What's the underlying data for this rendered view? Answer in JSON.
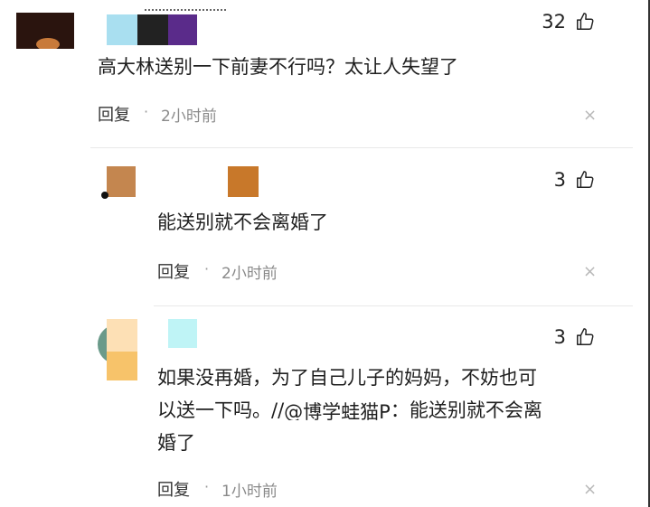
{
  "comments": [
    {
      "text": "高大林送别一下前妻不行吗？太让人失望了",
      "reply_label": "回复",
      "dot": "·",
      "time": "2小时前",
      "likes": "32",
      "close": "×",
      "icons": [
        "thumbs-up-icon",
        "close-icon"
      ]
    },
    {
      "text": "能送别就不会离婚了",
      "reply_label": "回复",
      "dot": "·",
      "time": "2小时前",
      "likes": "3",
      "close": "×"
    },
    {
      "text_line1": "如果没再婚，为了自己儿子的妈妈，不妨也可",
      "text_line2_a": "以送一下吗。//",
      "text_line2_mention": "@博学蛙猫P",
      "text_line2_b": "：能送别就不会离",
      "text_line3": "婚了",
      "reply_label": "回复",
      "dot": "·",
      "time": "1小时前",
      "likes": "3",
      "close": "×"
    }
  ],
  "colors": {
    "avatar_1": "#3a1a12",
    "badge_light_blue": "#a9dff0",
    "badge_dark": "#222222",
    "badge_purple": "#5a2b8a",
    "avatar_2": "#c4864f",
    "badge_orange": "#c8782a",
    "avatar_3_light": "#fde0b5",
    "avatar_3_mid": "#f7c36a",
    "badge_cyan": "#bff4f6"
  }
}
